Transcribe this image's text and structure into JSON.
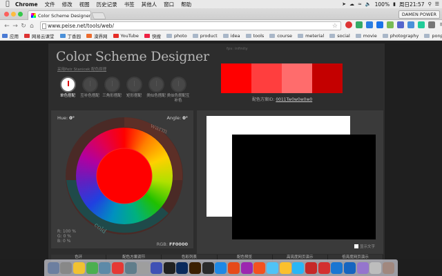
{
  "menubar": {
    "app": "Chrome",
    "items": [
      "文件",
      "修改",
      "视图",
      "历史记录",
      "书签",
      "其他人",
      "窗口",
      "帮助"
    ],
    "battery": "100%",
    "clock": "周日21:57"
  },
  "browser": {
    "tab_title": "Color Scheme Designer 3...",
    "profile": "DAMEN POWER",
    "url": "www.peise.net/tools/web/",
    "bookmarks": [
      {
        "label": "应用",
        "icon": "grid"
      },
      {
        "label": "网易云课堂",
        "icon": "ne"
      },
      {
        "label": "丁香园",
        "icon": "dz"
      },
      {
        "label": "漠界网",
        "icon": "mt"
      },
      {
        "label": "YouTube",
        "icon": "yt"
      },
      {
        "label": "快搜",
        "icon": "kj"
      },
      {
        "label": "photo",
        "icon": "folder"
      },
      {
        "label": "product",
        "icon": "folder"
      },
      {
        "label": "idea",
        "icon": "folder"
      },
      {
        "label": "tools",
        "icon": "folder"
      },
      {
        "label": "course",
        "icon": "folder"
      },
      {
        "label": "meterial",
        "icon": "folder"
      },
      {
        "label": "social",
        "icon": "folder"
      },
      {
        "label": "movie",
        "icon": "folder"
      },
      {
        "label": "photography",
        "icon": "folder"
      },
      {
        "label": "ponpare",
        "icon": "folder"
      }
    ]
  },
  "designer": {
    "title": "Color Scheme Designer",
    "credit": "采用Petr Stanicek 配色原理",
    "fps": "fps: infinity",
    "schemes": [
      {
        "label": "单色搭配",
        "active": true
      },
      {
        "label": "互补色搭配",
        "active": false
      },
      {
        "label": "三角形搭配",
        "active": false
      },
      {
        "label": "矩形搭配",
        "active": false
      },
      {
        "label": "类似色搭配",
        "active": false
      },
      {
        "label": "类似色搭配互补色",
        "active": false
      }
    ],
    "swatches": [
      "#ff0000",
      "#ff3e3e",
      "#ff6c6c",
      "#c40000"
    ],
    "scheme_id_label": "配色方案ID:",
    "scheme_id": "0011Tw0w0w0w0",
    "hue_label": "Hue:",
    "hue_value": "0°",
    "angle_label": "Angle:",
    "angle_value": "0°",
    "wheel_warm": "warm",
    "wheel_cold": "cold",
    "rgb_r": "R: 100 %",
    "rgb_g": "G:    0 %",
    "rgb_b": "B:    0 %",
    "rgb_hex_label": "RGB:",
    "rgb_hex": "FF0000",
    "show_text": "显示文字",
    "bottom_tabs": [
      "色环",
      "配色方案调节",
      "色彩列表",
      "配色预览",
      "高亮度网页演示",
      "低亮度网页演示"
    ]
  },
  "dock": {
    "colors": [
      "#6d7fa0",
      "#888",
      "#f1c232",
      "#4caf50",
      "#5d8aa8",
      "#e53935",
      "#607d8b",
      "#9e9e9e",
      "#3f51b5",
      "#212121",
      "#0b2a5c",
      "#3b1f00",
      "#2b2b2b",
      "#1e88e5",
      "#e64a19",
      "#9c27b0",
      "#f4511e",
      "#4fc3f7",
      "#fbc02d",
      "#29b6f6",
      "#c62828",
      "#d32f2f",
      "#1976d2",
      "#1565c0",
      "#9575cd",
      "#bdbdbd",
      "#a1887f"
    ]
  }
}
